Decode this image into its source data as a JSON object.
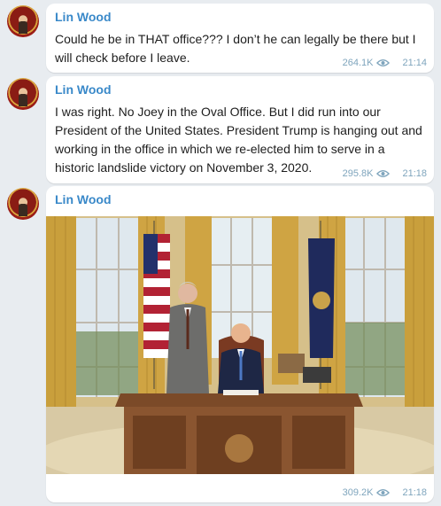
{
  "messages": [
    {
      "sender": "Lin Wood",
      "text": "Could he be in THAT office??? I don’t he can legally be there but I will check before I leave.",
      "views": "264.1K",
      "time": "21:14"
    },
    {
      "sender": "Lin Wood",
      "text": "I was right. No Joey in the Oval Office. But I did run into our President of the United States. President Trump is hanging out and working in the office in which we re-elected him to serve in a historic landslide victory on November 3, 2020.",
      "views": "295.8K",
      "time": "21:18"
    },
    {
      "sender": "Lin Wood",
      "views": "309.2K",
      "time": "21:18",
      "photo": "oval-office-photo"
    }
  ],
  "icons": {
    "avatar": "avatar-icon",
    "views": "eye-icon"
  },
  "colors": {
    "background": "#e8ecf0",
    "bubble": "#ffffff",
    "sender": "#3a89c9",
    "meta": "#7fa5bd"
  }
}
